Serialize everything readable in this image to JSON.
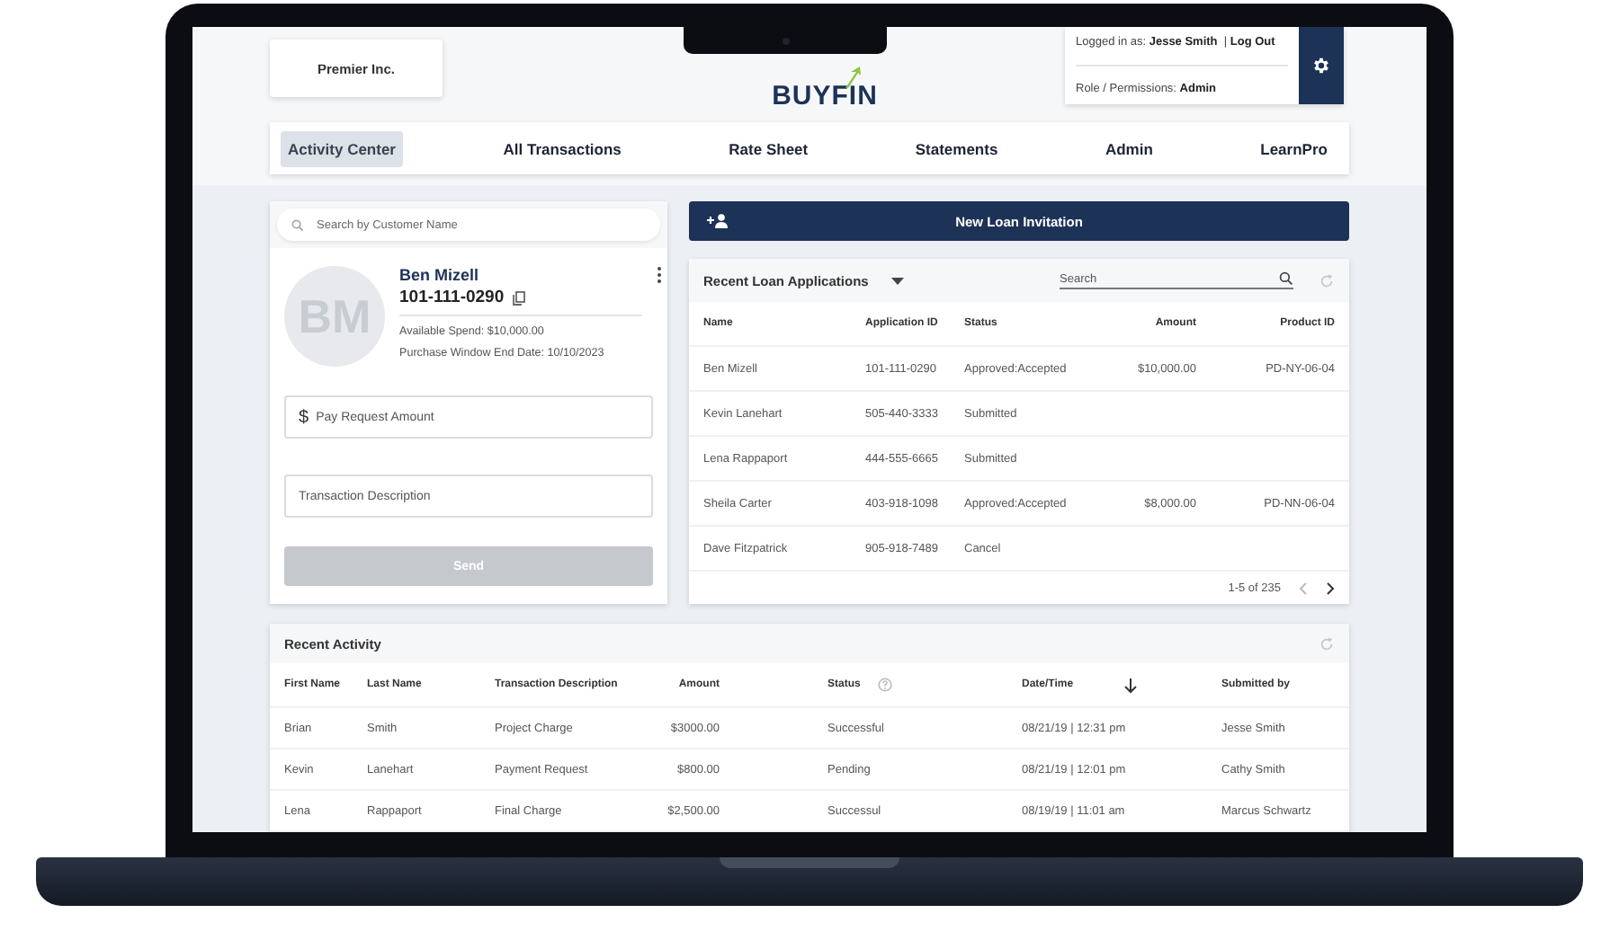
{
  "header": {
    "company": "Premier Inc.",
    "logo": "BUYFIN",
    "logged_in_label": "Logged in as:",
    "user": "Jesse Smith",
    "separator": "|",
    "logout": "Log Out",
    "role_label": "Role / Permissions:",
    "role": "Admin"
  },
  "nav": [
    {
      "label": "Activity Center",
      "selected": true
    },
    {
      "label": "All Transactions",
      "selected": false
    },
    {
      "label": "Rate Sheet",
      "selected": false
    },
    {
      "label": "Statements",
      "selected": false
    },
    {
      "label": "Admin",
      "selected": false
    },
    {
      "label": "LearnPro",
      "selected": false
    }
  ],
  "customer": {
    "search_placeholder": "Search by Customer Name",
    "initials": "BM",
    "name": "Ben Mizell",
    "account": "101-111-0290",
    "available": "Available Spend: $10,000.00",
    "window_end": "Purchase Window End Date: 10/10/2023",
    "currency": "$",
    "amount_placeholder": "Pay Request Amount",
    "description_placeholder": "Transaction Description",
    "send": {
      "label": "Send",
      "disabled": true
    }
  },
  "new_loan_button": "New Loan Invitation",
  "loan_applications": {
    "title": "Recent Loan Applications",
    "search_placeholder": "Search",
    "columns": [
      "Name",
      "Application ID",
      "Status",
      "Amount",
      "Product ID"
    ],
    "rows": [
      [
        "Ben Mizell",
        "101-111-0290",
        "Approved:Accepted",
        "$10,000.00",
        "PD-NY-06-04"
      ],
      [
        "Kevin Lanehart",
        "505-440-3333",
        "Submitted",
        "",
        ""
      ],
      [
        "Lena Rappaport",
        "444-555-6665",
        "Submitted",
        "",
        ""
      ],
      [
        "Sheila Carter",
        "403-918-1098",
        "Approved:Accepted",
        "$8,000.00",
        "PD-NN-06-04"
      ],
      [
        "Dave Fitzpatrick",
        "905-918-7489",
        "Cancel",
        "",
        ""
      ]
    ],
    "pagination": "1-5 of 235"
  },
  "recent_activity": {
    "title": "Recent Activity",
    "columns": [
      "First Name",
      "Last Name",
      "Transaction Description",
      "Amount",
      "Status",
      "Date/Time",
      "Submitted by"
    ],
    "rows": [
      [
        "Brian",
        "Smith",
        "Project Charge",
        "$3000.00",
        "Successful",
        "08/21/19  |  12:31 pm",
        "Jesse Smith"
      ],
      [
        "Kevin",
        "Lanehart",
        "Payment Request",
        "$800.00",
        "Pending",
        "08/21/19  |  12:01 pm",
        "Cathy  Smith"
      ],
      [
        "Lena",
        "Rappaport",
        "Final Charge",
        "$2,500.00",
        "Successul",
        "08/19/19  |  11:01 am",
        "Marcus Schwartz"
      ]
    ]
  }
}
